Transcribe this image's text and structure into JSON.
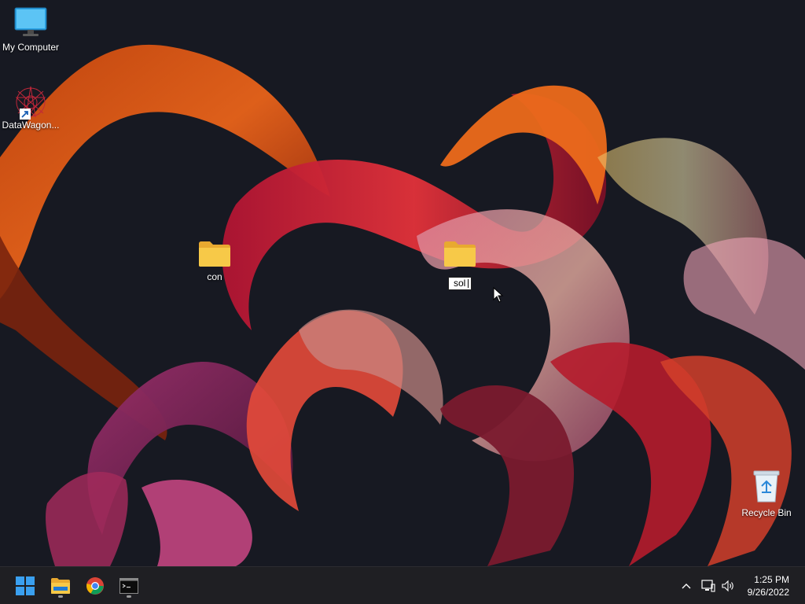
{
  "desktop": {
    "icons": {
      "my_computer": "My Computer",
      "datawagon": "DataWagon...",
      "folder_con": "con",
      "recycle_bin": "Recycle Bin"
    },
    "rename_value": "sol"
  },
  "taskbar": {
    "pinned": [
      {
        "name": "start-button",
        "icon": "windows-logo-icon"
      },
      {
        "name": "file-explorer-button",
        "icon": "folder-icon"
      },
      {
        "name": "chrome-button",
        "icon": "chrome-icon"
      },
      {
        "name": "terminal-button",
        "icon": "terminal-icon"
      }
    ],
    "clock": {
      "time": "1:25 PM",
      "date": "9/26/2022"
    },
    "tray": [
      "chevron-up-icon",
      "network-icon",
      "volume-icon"
    ]
  },
  "colors": {
    "taskbar_bg": "#1f1f23",
    "folder_yellow": "#f7c948",
    "accent_blue": "#0078d4"
  }
}
